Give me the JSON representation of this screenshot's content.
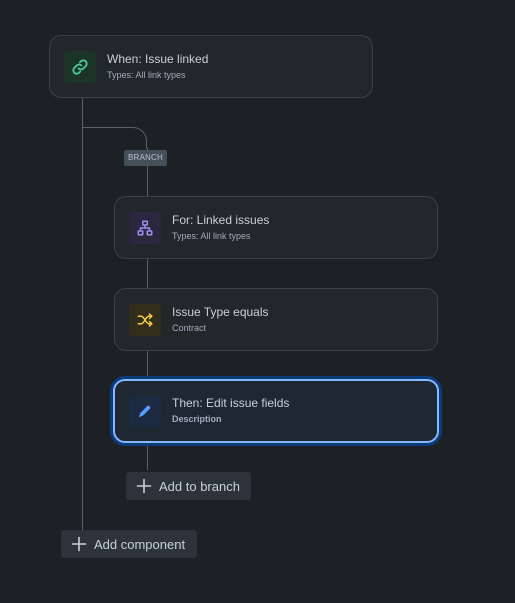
{
  "trigger": {
    "title": "When: Issue linked",
    "subtitle": "Types: All link types",
    "icon": "link-icon",
    "icon_bg": "#1c3329",
    "icon_color": "#4bce97"
  },
  "branch_label": "BRANCH",
  "branch_items": [
    {
      "title": "For: Linked issues",
      "subtitle": "Types: All link types",
      "icon": "hierarchy-icon",
      "icon_bg": "#2b273f",
      "icon_color": "#9f8fef"
    },
    {
      "title": "Issue Type equals",
      "subtitle": "Contract",
      "icon": "shuffle-icon",
      "icon_bg": "#332e1b",
      "icon_color": "#f5cd47"
    },
    {
      "title": "Then: Edit issue fields",
      "subtitle": "Description",
      "icon": "pencil-icon",
      "icon_bg": "#1c2b41",
      "icon_color": "#579dff",
      "selected": true
    }
  ],
  "add_to_branch_label": "Add to branch",
  "add_component_label": "Add component",
  "colors": {
    "background": "#1d2125",
    "card": "#22272b",
    "selected_border": "#85b8ff",
    "connector": "#5a6169"
  }
}
